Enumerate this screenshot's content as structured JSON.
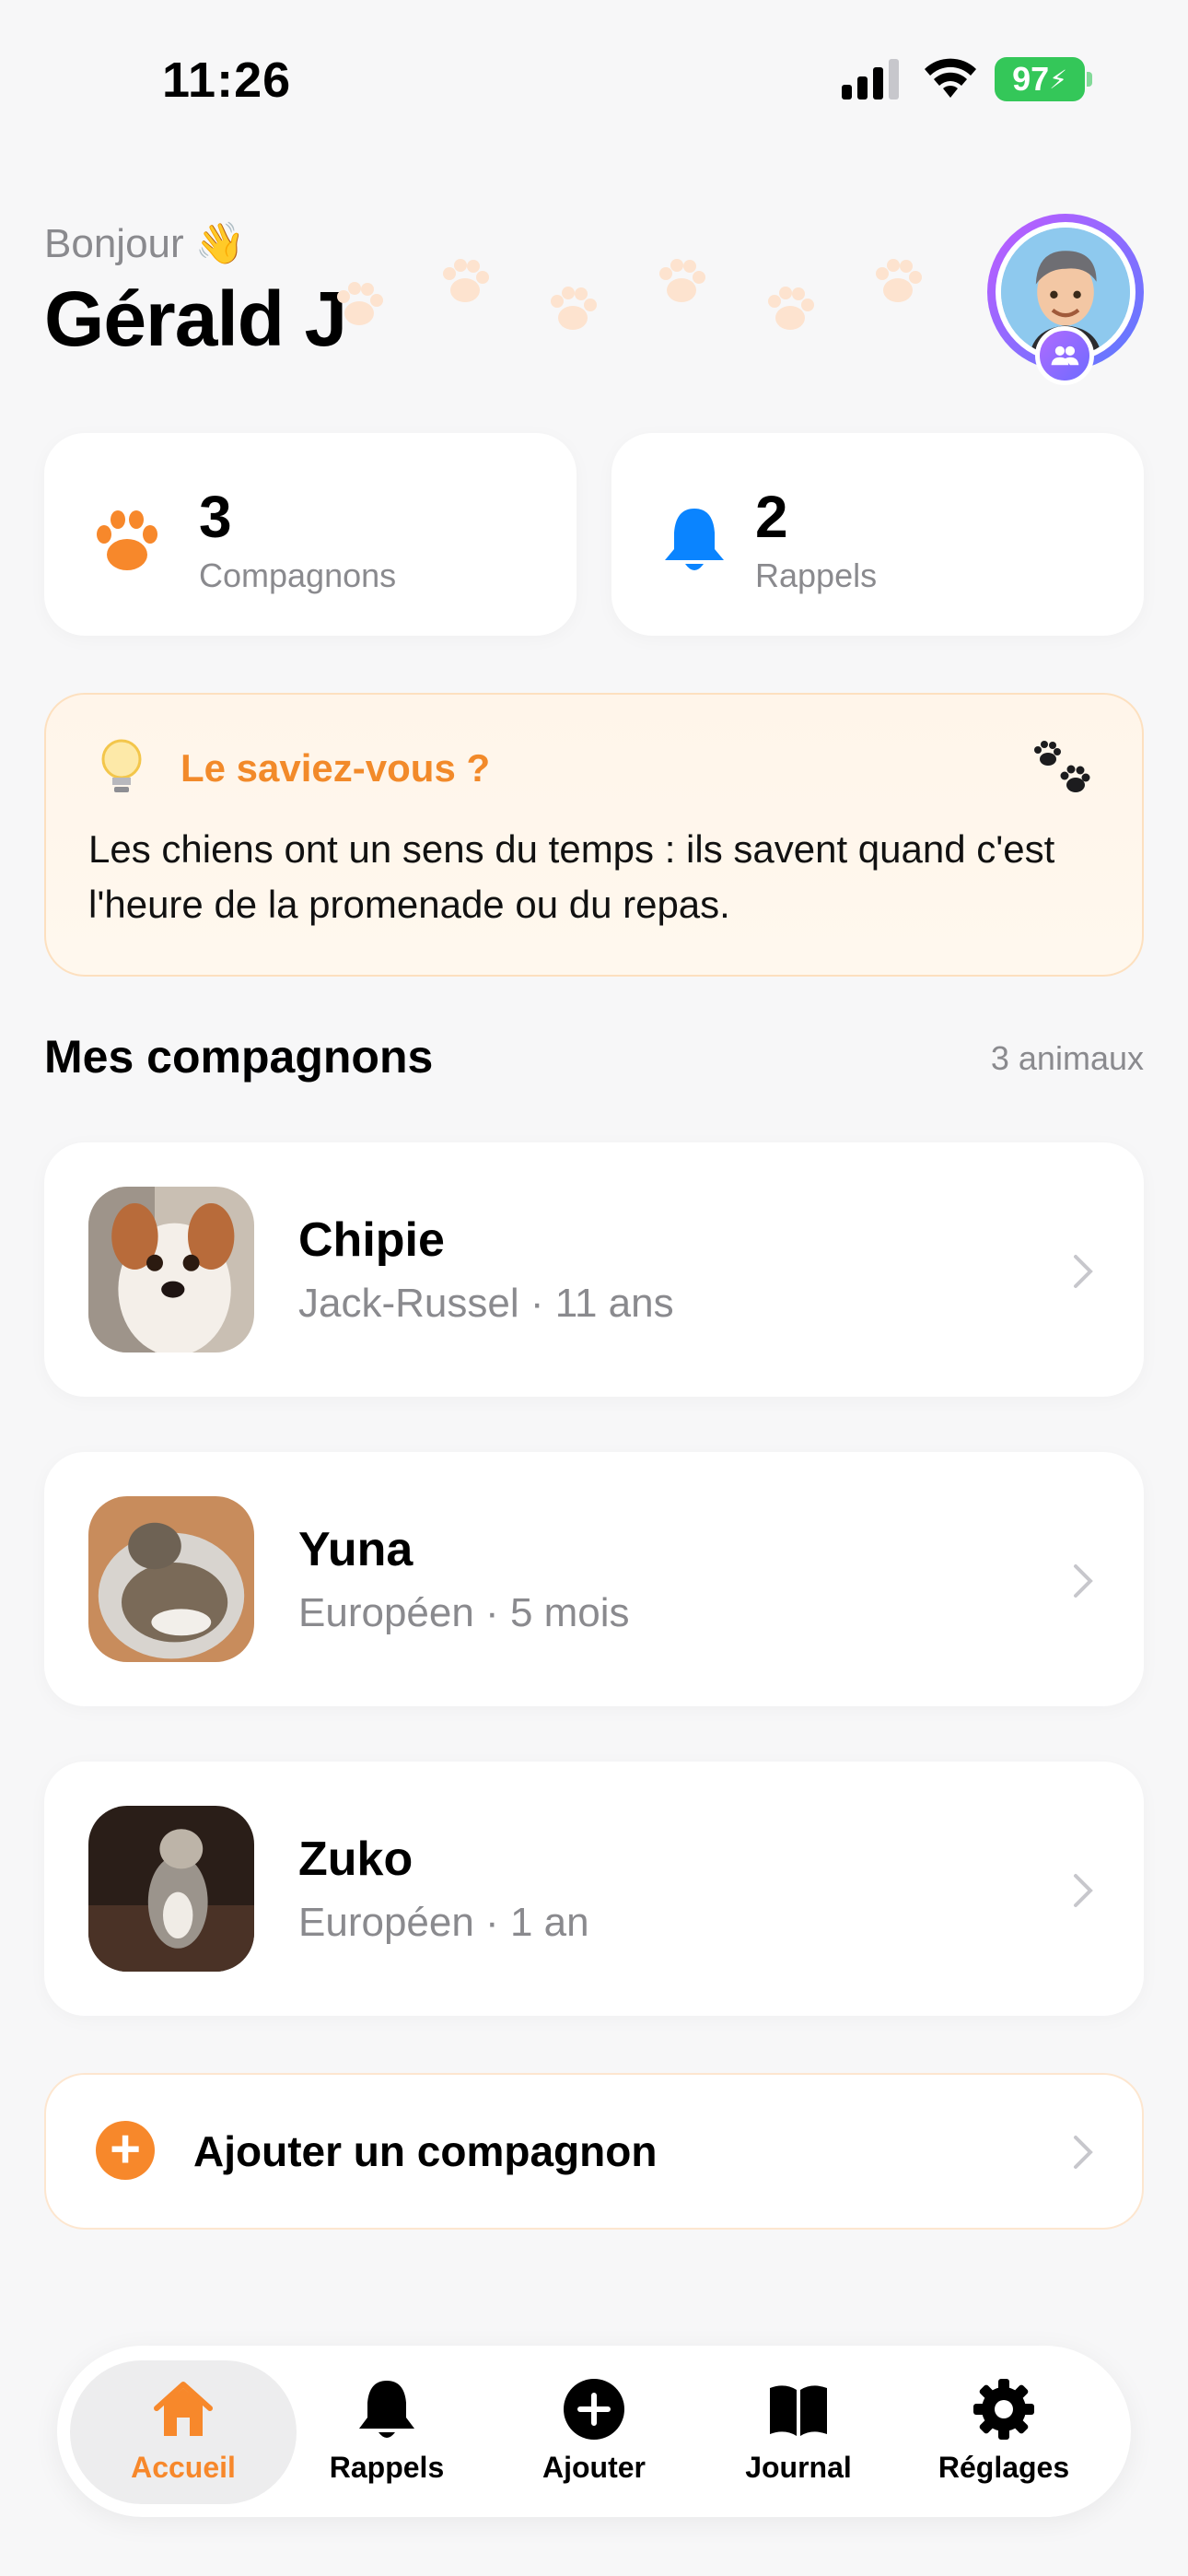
{
  "status_bar": {
    "time": "11:26",
    "battery": "97"
  },
  "header": {
    "greeting": "Bonjour 👋",
    "user_name": "Gérald J"
  },
  "stats": [
    {
      "value": "3",
      "label": "Compagnons",
      "icon": "paw-icon",
      "color": "#f7882b"
    },
    {
      "value": "2",
      "label": "Rappels",
      "icon": "bell-icon",
      "color": "#0a84ff"
    }
  ],
  "tip": {
    "title": "Le saviez-vous ?",
    "text": "Les chiens ont un sens du temps : ils savent quand c'est l'heure de la promenade ou du repas."
  },
  "section": {
    "title": "Mes compagnons",
    "count": "3 animaux"
  },
  "pets": [
    {
      "name": "Chipie",
      "breed": "Jack-Russel",
      "age": "11 ans"
    },
    {
      "name": "Yuna",
      "breed": "Européen",
      "age": "5 mois"
    },
    {
      "name": "Zuko",
      "breed": "Européen",
      "age": "1 an"
    }
  ],
  "add_button": {
    "label": "Ajouter un compagnon"
  },
  "tabs": [
    {
      "label": "Accueil",
      "icon": "house-icon",
      "active": true
    },
    {
      "label": "Rappels",
      "icon": "bell-icon"
    },
    {
      "label": "Ajouter",
      "icon": "plus-circle-icon"
    },
    {
      "label": "Journal",
      "icon": "book-icon"
    },
    {
      "label": "Réglages",
      "icon": "gear-icon"
    }
  ],
  "colors": {
    "accent": "#f7882b",
    "blue": "#0a84ff",
    "battery": "#34c759"
  }
}
